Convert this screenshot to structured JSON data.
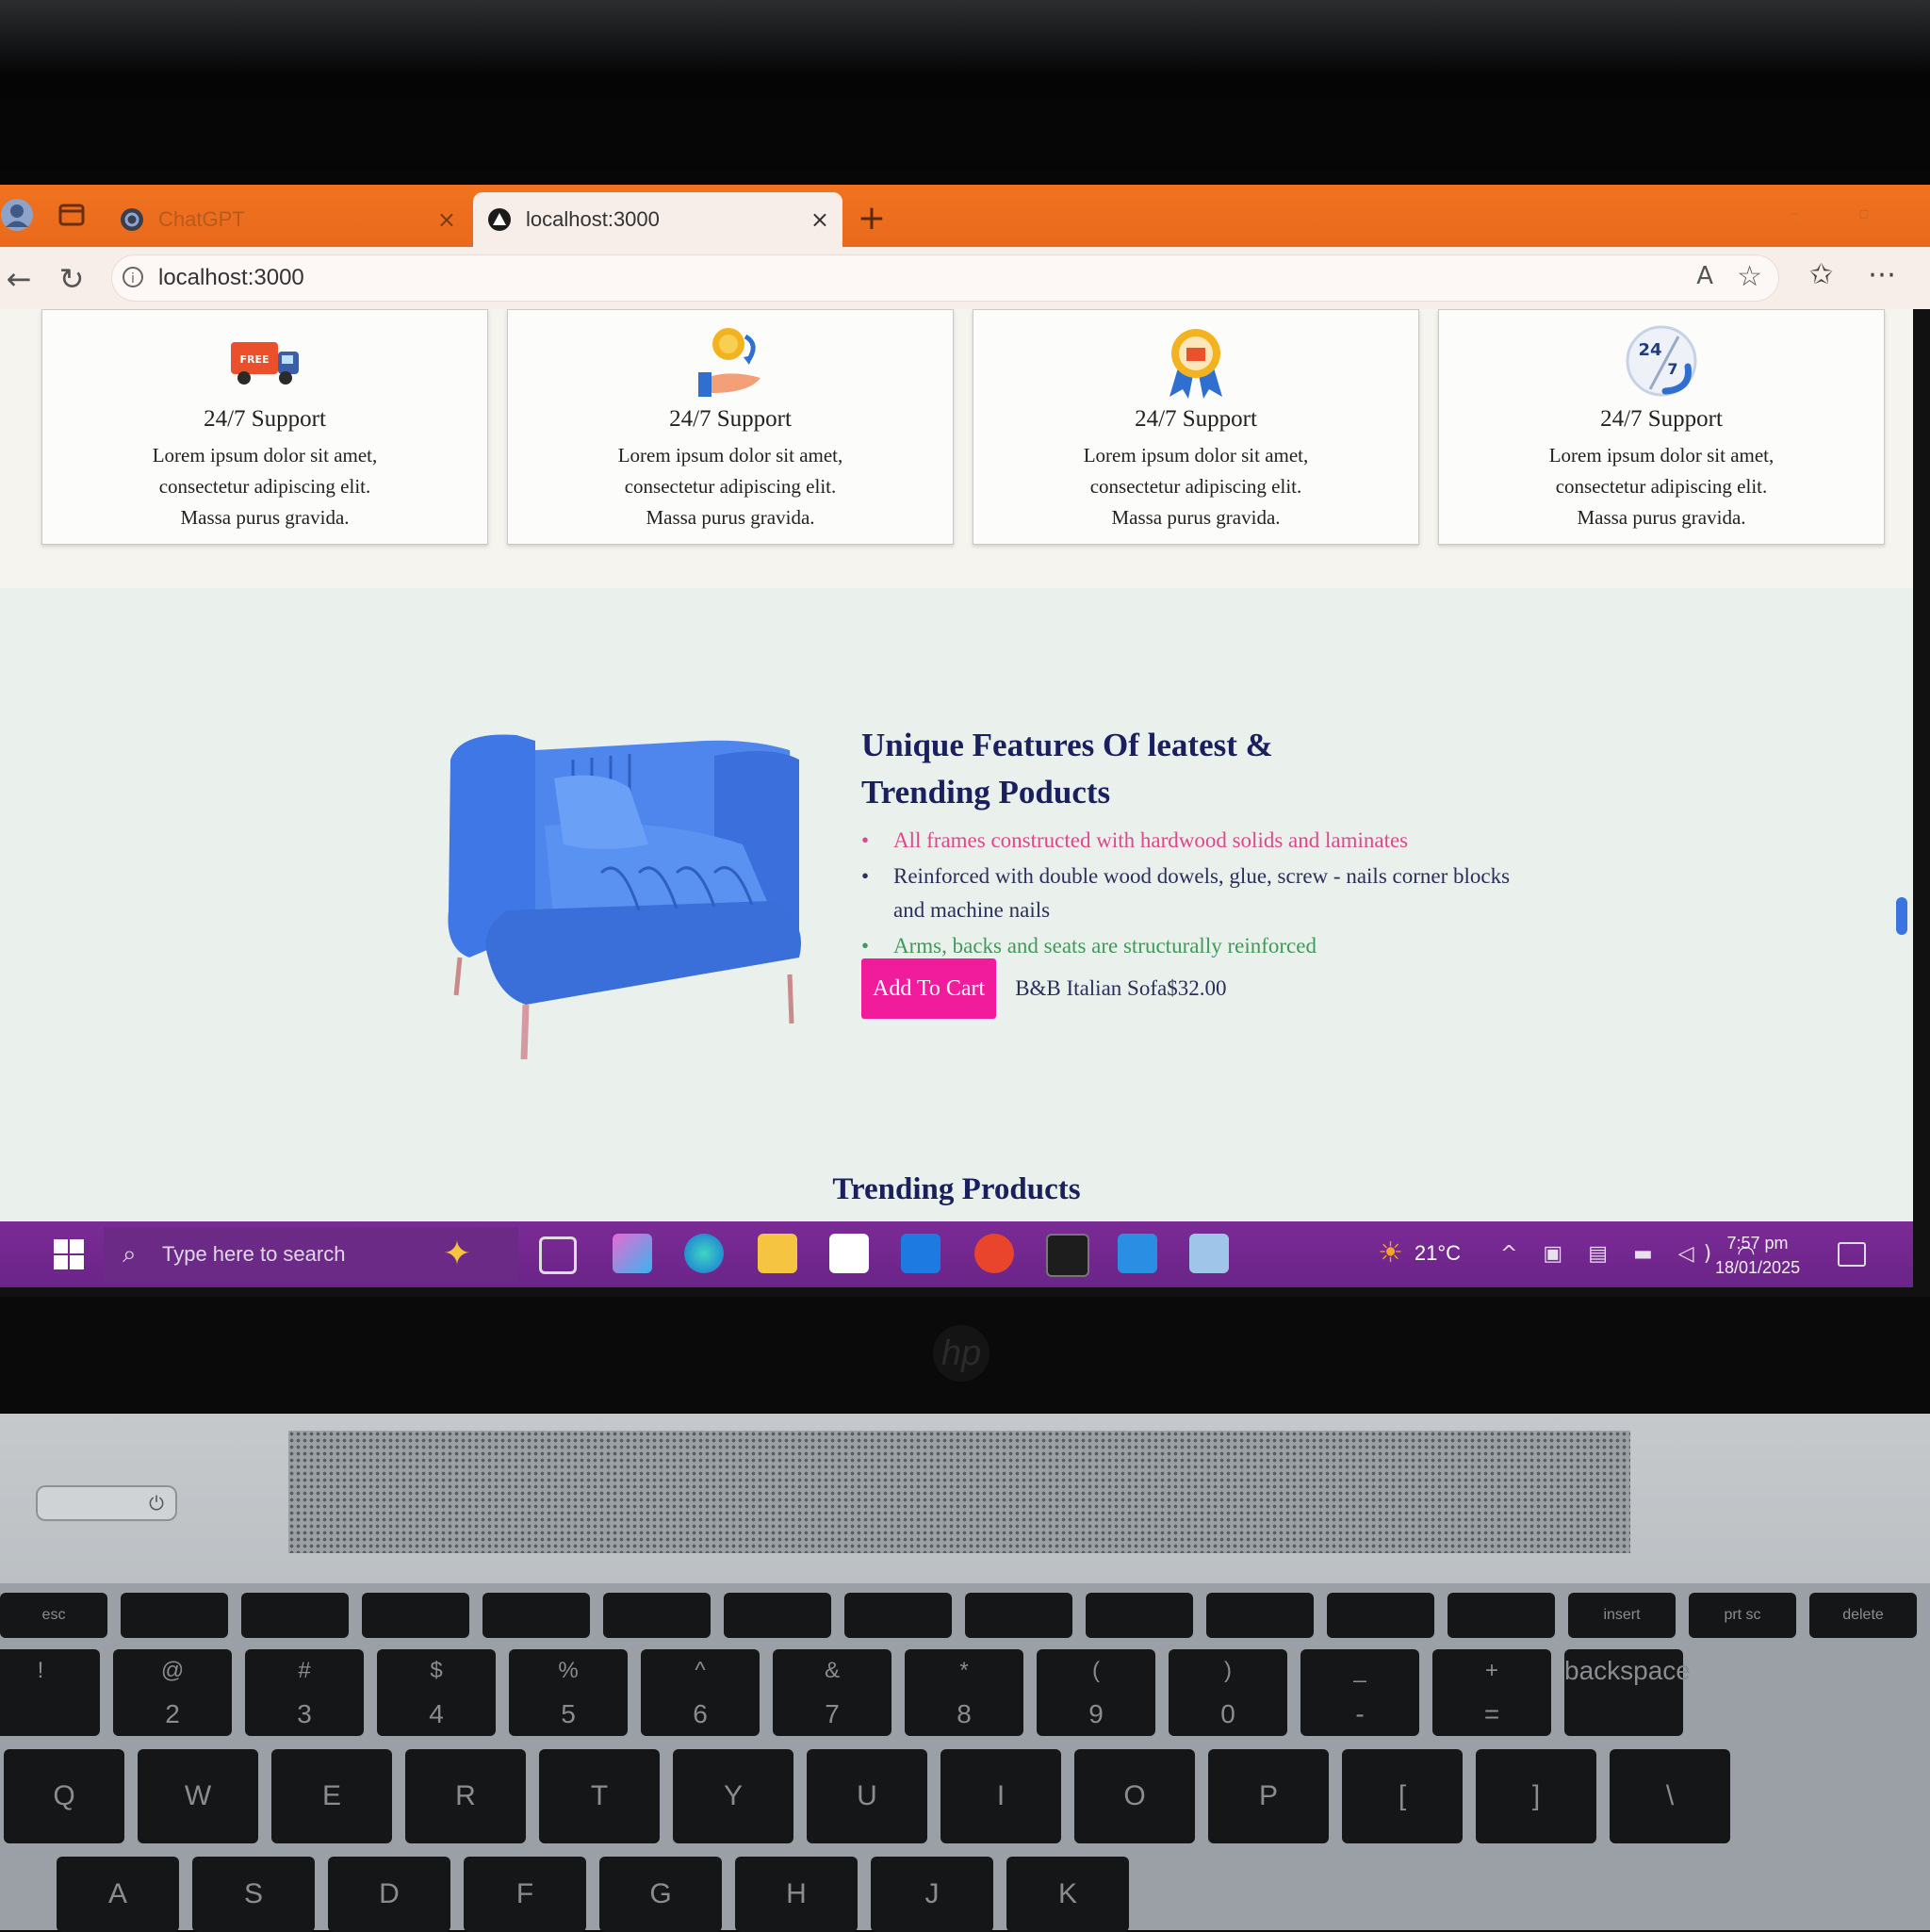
{
  "browser": {
    "tabs": [
      {
        "title": "ChatGPT",
        "active": false
      },
      {
        "title": "localhost:3000",
        "active": true
      }
    ],
    "new_tab_symbol": "+",
    "close_symbol": "×",
    "url": "localhost:3000"
  },
  "features": [
    {
      "icon": "free-delivery-truck-icon",
      "badge": "FREE",
      "title": "24/7 Support",
      "text": [
        "Lorem ipsum dolor sit amet,",
        "consectetur adipiscing elit.",
        "Massa purus gravida."
      ]
    },
    {
      "icon": "coin-hand-icon",
      "title": "24/7 Support",
      "text": [
        "Lorem ipsum dolor sit amet,",
        "consectetur adipiscing elit.",
        "Massa purus gravida."
      ]
    },
    {
      "icon": "award-ribbon-icon",
      "title": "24/7 Support",
      "text": [
        "Lorem ipsum dolor sit amet,",
        "consectetur adipiscing elit.",
        "Massa purus gravida."
      ]
    },
    {
      "icon": "24-7-phone-icon",
      "badge_top": "24",
      "badge_bottom": "7",
      "title": "24/7 Support",
      "text": [
        "Lorem ipsum dolor sit amet,",
        "consectetur adipiscing elit.",
        "Massa purus gravida."
      ]
    }
  ],
  "unique_section": {
    "title": "Unique Features Of leatest & Trending Poducts",
    "bullets": [
      {
        "text": "All frames constructed with hardwood solids and laminates",
        "color": "#e0478a"
      },
      {
        "text": "Reinforced with double wood dowels, glue, screw - nails corner blocks and machine nails",
        "color": "#2b2f5a"
      },
      {
        "text": "Arms, backs and seats are structurally reinforced",
        "color": "#3f9a5a"
      }
    ],
    "button_label": "Add To Cart",
    "product_name": "B&B Italian Sofa",
    "product_price": "$32.00"
  },
  "trending_title": "Trending Products",
  "taskbar": {
    "search_placeholder": "Type here to search",
    "apps": [
      "copilot-icon",
      "edge-icon",
      "file-explorer-icon",
      "store-icon",
      "outlook-icon",
      "wps-office-icon",
      "terminal-icon",
      "vscode-icon",
      "notes-icon"
    ],
    "weather": "21°C",
    "time": "7:57 pm",
    "date": "18/01/2025"
  },
  "keyboard": {
    "function_row": [
      "esc",
      "",
      "",
      "",
      "",
      "",
      "",
      "",
      "",
      "",
      "",
      "",
      "",
      "insert",
      "prt sc",
      "delete"
    ],
    "number_row": [
      "",
      "2",
      "3",
      "4",
      "5",
      "6",
      "7",
      "8",
      "9",
      "0",
      "-",
      "=",
      "backspace"
    ],
    "number_row_shift": [
      "!",
      "@",
      "#",
      "$",
      "%",
      "^",
      "&",
      "*",
      "(",
      ")",
      "_",
      "+",
      ""
    ],
    "qwerty_row": [
      "Q",
      "W",
      "E",
      "R",
      "T",
      "Y",
      "U",
      "I",
      "O",
      "P",
      "[",
      "]",
      "\\"
    ],
    "home_row": [
      "A",
      "S",
      "D",
      "F",
      "G",
      "H",
      "J",
      "K"
    ]
  },
  "colors": {
    "tab_strip": "#f0731f",
    "taskbar": "#7b2b96",
    "heading": "#1a1f5e",
    "cart_button": "#f01c9c",
    "sofa": "#3f78e6"
  }
}
